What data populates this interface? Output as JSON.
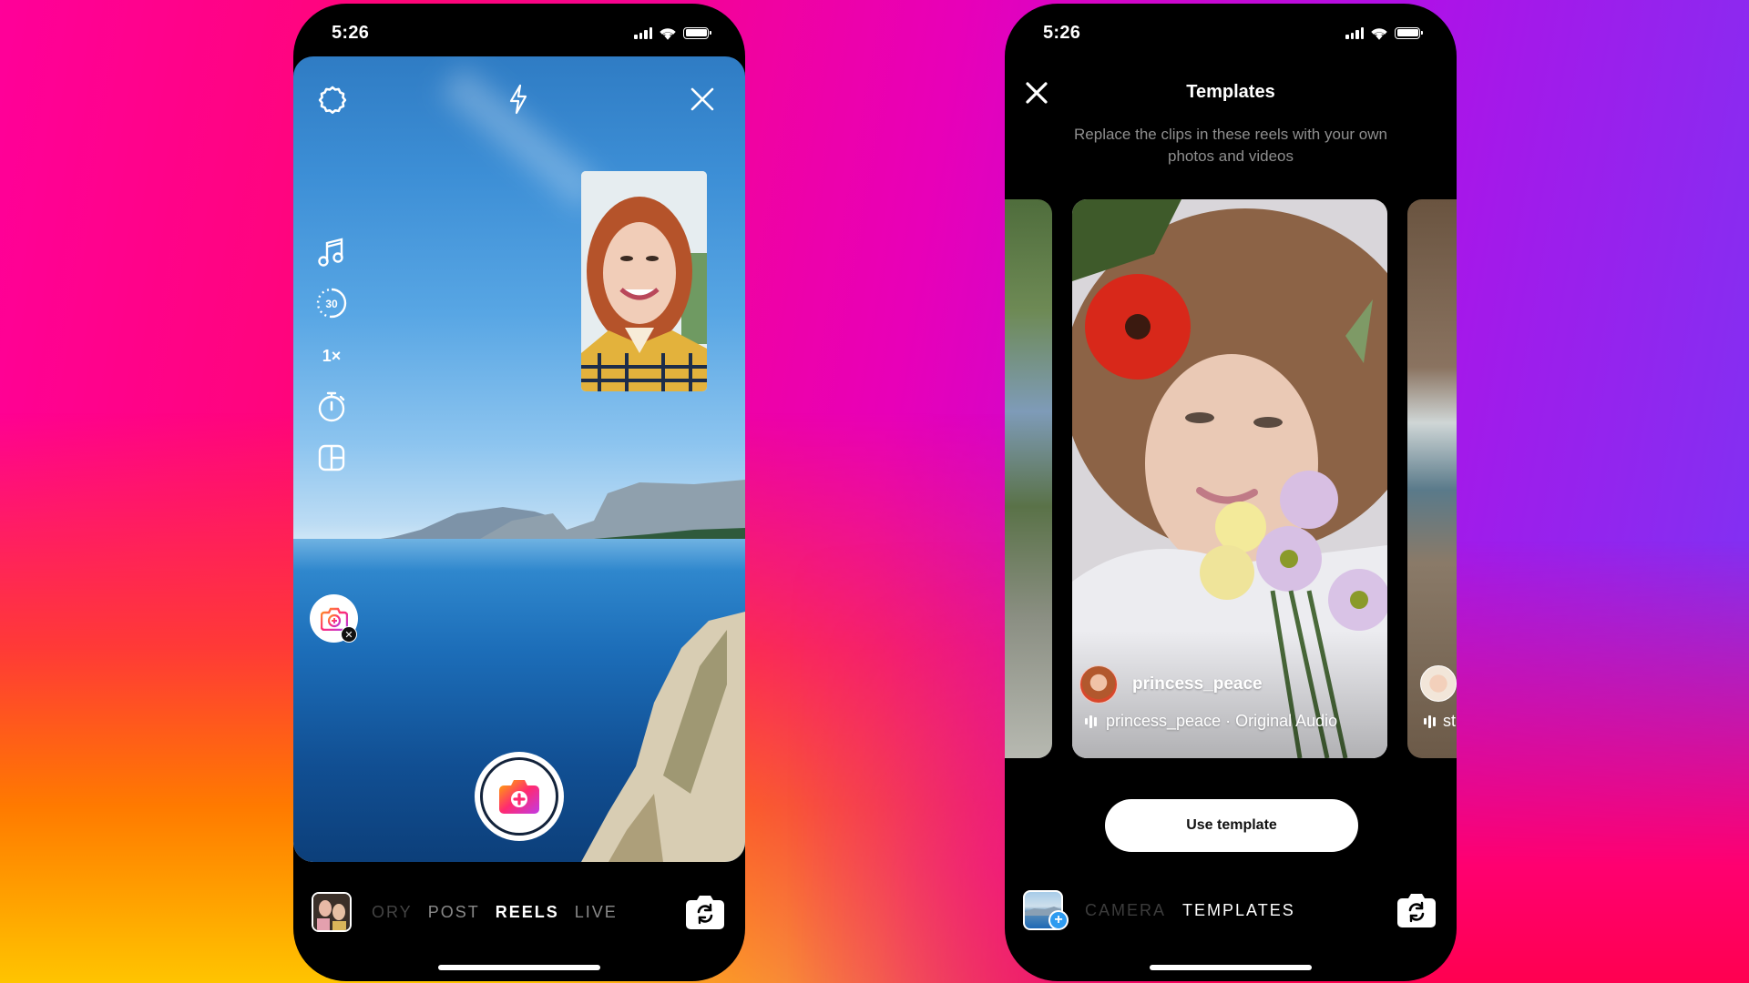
{
  "colors": {
    "background_gradient": [
      "#ff0099",
      "#ff3a36",
      "#ffc400",
      "#b20fe6",
      "#7b35f4"
    ],
    "phone_bg": "#000000",
    "accent_blue": "#2e9bf0",
    "shutter_gradient": [
      "#ffb400",
      "#ff2d6f",
      "#c03be0"
    ]
  },
  "left_phone": {
    "status_bar": {
      "time": "5:26"
    },
    "camera": {
      "top_icons": [
        "settings-icon",
        "flash-icon",
        "close-icon"
      ],
      "side_tools": [
        {
          "icon": "music-icon",
          "label": "Audio"
        },
        {
          "icon": "timer-length-icon",
          "label": "30"
        },
        {
          "icon": "speed-icon",
          "label": "1×"
        },
        {
          "icon": "countdown-timer-icon",
          "label": "Timer"
        },
        {
          "icon": "layout-icon",
          "label": "Layout"
        },
        {
          "icon": "effect-camera-icon",
          "label": "Effect"
        }
      ],
      "length_value": "30",
      "speed_value": "1×",
      "remove_effect_glyph": "✕"
    },
    "bottom_bar": {
      "modes": [
        "ORY",
        "POST",
        "REELS",
        "LIVE"
      ],
      "active_mode": "REELS"
    }
  },
  "right_phone": {
    "status_bar": {
      "time": "5:26"
    },
    "header": {
      "title": "Templates",
      "subtitle": "Replace the clips in these reels with your own photos and videos"
    },
    "cards": {
      "main": {
        "username": "princess_peace",
        "audio": "princess_peace · Original Audio"
      },
      "right_partial_audio": "st"
    },
    "use_template_label": "Use template",
    "bottom_bar": {
      "modes": [
        "CAMERA",
        "TEMPLATES"
      ],
      "active_mode": "TEMPLATES",
      "gallery_plus": "+"
    }
  }
}
